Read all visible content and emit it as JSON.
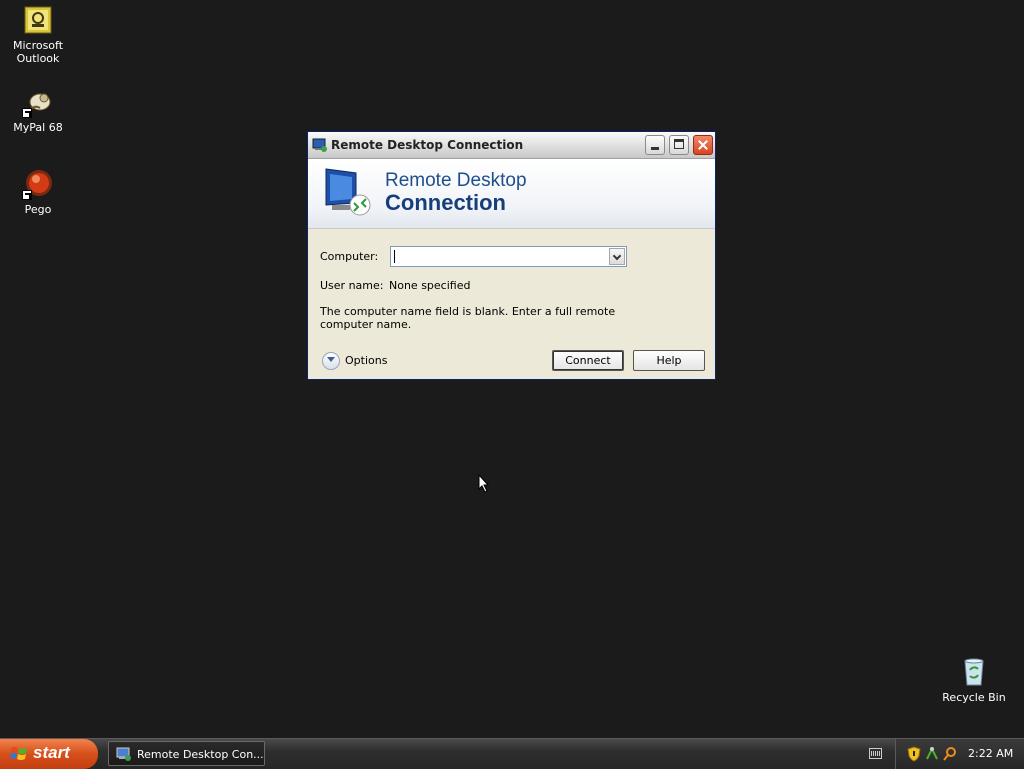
{
  "desktop": {
    "icons": [
      {
        "label_line1": "Microsoft",
        "label_line2": "Outlook",
        "icon": "outlook-icon"
      },
      {
        "label_line1": "MyPal 68",
        "label_line2": "",
        "icon": "mypal-icon"
      },
      {
        "label_line1": "Pego",
        "label_line2": "",
        "icon": "pego-icon"
      },
      {
        "label_line1": "Recycle Bin",
        "label_line2": "",
        "icon": "recycle-bin-icon"
      }
    ]
  },
  "window": {
    "title": "Remote Desktop Connection",
    "banner": {
      "line1": "Remote Desktop",
      "line2": "Connection"
    },
    "computer_label": "Computer:",
    "computer_value": "",
    "username_label": "User name:",
    "username_value": "None specified",
    "hint": "The computer name field is blank. Enter a full remote computer name.",
    "options_label": "Options",
    "connect_label": "Connect",
    "help_label": "Help"
  },
  "taskbar": {
    "start_label": "start",
    "task_label": "Remote Desktop Con...",
    "clock": "2:22 AM"
  },
  "colors": {
    "desktop_bg": "#1b1b1b",
    "window_bg": "#ece9d8",
    "banner_text": "#1f4e8f",
    "start_button": "#d4501b"
  }
}
